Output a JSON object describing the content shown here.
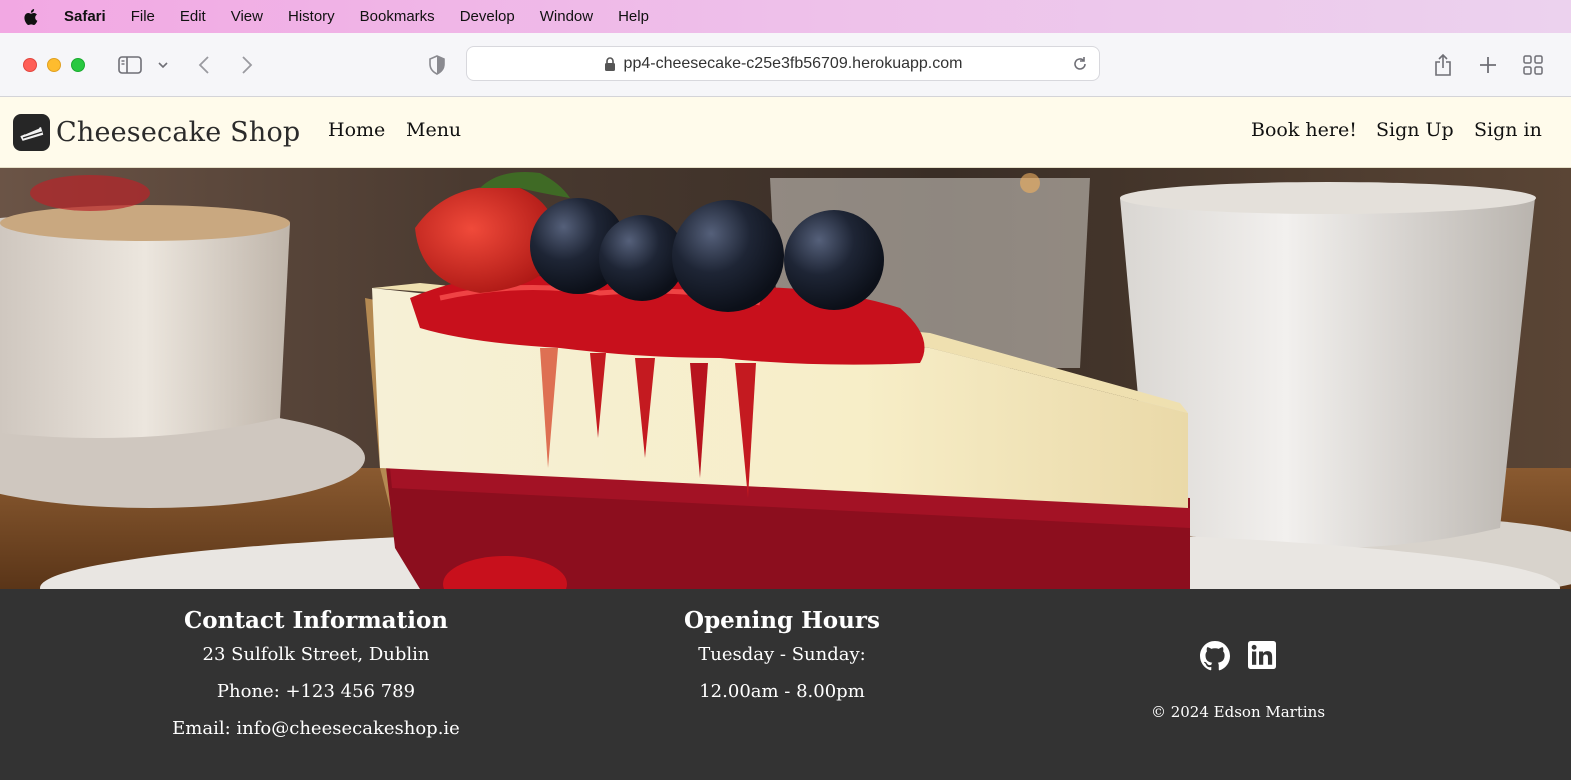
{
  "menubar": {
    "app": "Safari",
    "items": [
      "File",
      "Edit",
      "View",
      "History",
      "Bookmarks",
      "Develop",
      "Window",
      "Help"
    ]
  },
  "browser": {
    "url": "pp4-cheesecake-c25e3fb56709.herokuapp.com"
  },
  "nav": {
    "brand": "Cheesecake Shop",
    "links": [
      "Home",
      "Menu"
    ],
    "right_links": [
      "Book here!",
      "Sign Up",
      "Sign in"
    ]
  },
  "hero": {
    "image_alt": "cheesecake-hero-image"
  },
  "footer": {
    "contact": {
      "title": "Contact Information",
      "address": "23 Sulfolk Street, Dublin",
      "phone": "Phone: +123 456 789",
      "email": "Email: info@cheesecakeshop.ie"
    },
    "hours": {
      "title": "Opening Hours",
      "days": "Tuesday - Sunday:",
      "times": "12.00am - 8.00pm"
    },
    "copyright": "© 2024 Edson Martins",
    "social_icons": [
      "github-icon",
      "linkedin-icon"
    ]
  },
  "colors": {
    "menubar": "#f2a8e3",
    "navbar_bg": "#fffbeb",
    "footer_bg": "#333333"
  }
}
